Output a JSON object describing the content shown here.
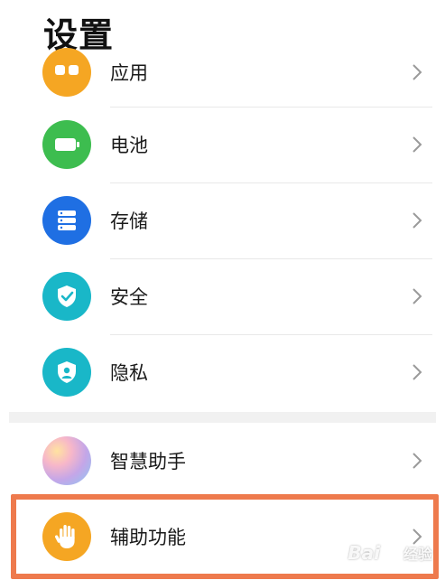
{
  "page_title": "设置",
  "items": [
    {
      "label": "应用",
      "icon": "apps-icon",
      "color": "#f5a623"
    },
    {
      "label": "电池",
      "icon": "battery-icon",
      "color": "#3dbd4f"
    },
    {
      "label": "存储",
      "icon": "storage-icon",
      "color": "#1f6fe3"
    },
    {
      "label": "安全",
      "icon": "shield-check-icon",
      "color": "#19b7c8"
    },
    {
      "label": "隐私",
      "icon": "privacy-shield-icon",
      "color": "#19b7c8"
    },
    {
      "label": "智慧助手",
      "icon": "smart-assistant-icon",
      "color": "#c4a6e8"
    },
    {
      "label": "辅助功能",
      "icon": "hand-icon",
      "color": "#f5a623"
    }
  ],
  "watermark": {
    "text": "Bai",
    "suffix": "经验"
  }
}
